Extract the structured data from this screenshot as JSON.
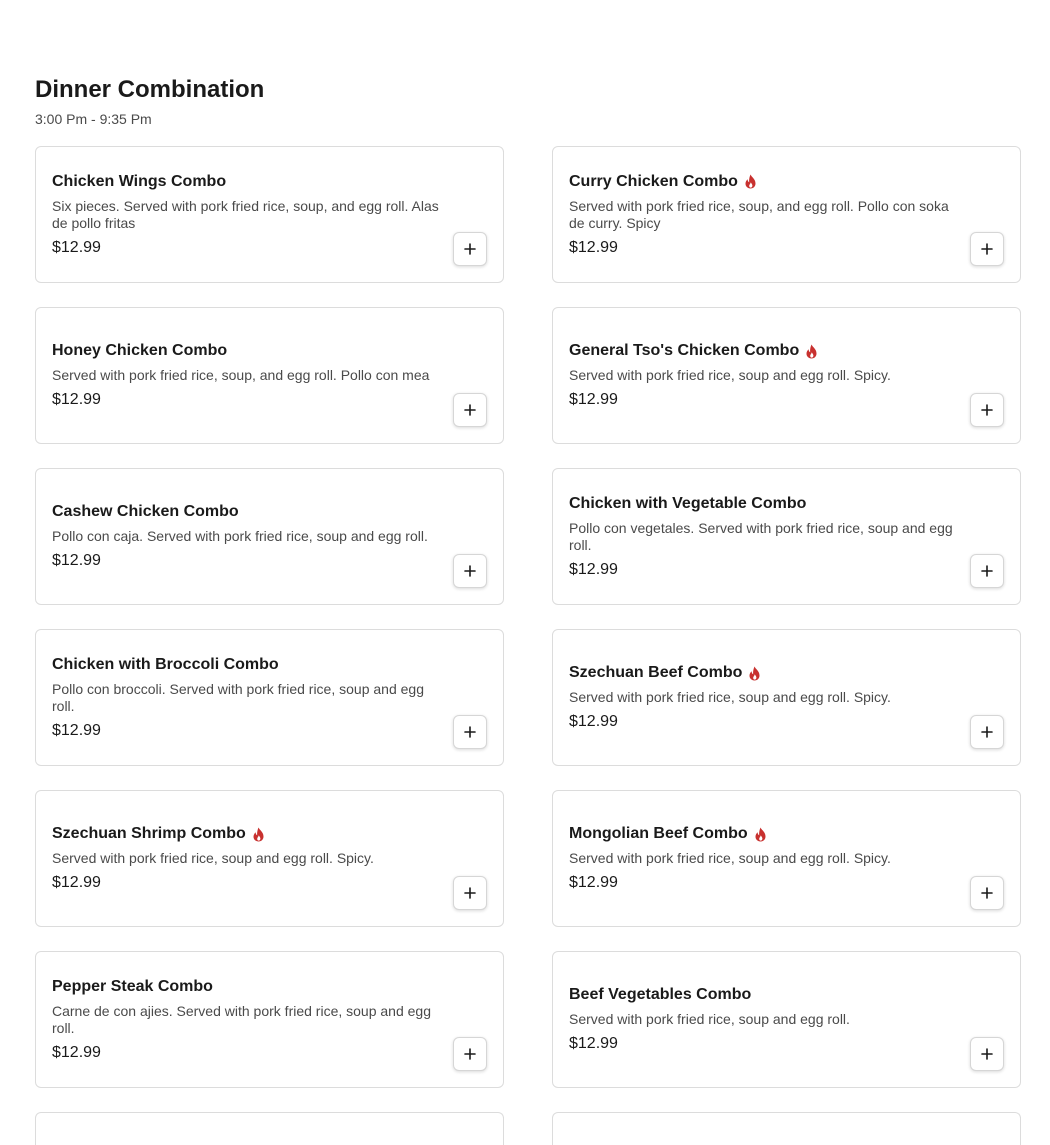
{
  "section": {
    "title": "Dinner Combination",
    "hours": "3:00 Pm - 9:35 Pm"
  },
  "colors": {
    "spicy": "#c8312f",
    "border": "#dcdcdc"
  },
  "icons": {
    "spicy": "flame-icon",
    "add": "plus-icon"
  },
  "items": [
    {
      "name": "Chicken Wings Combo",
      "spicy": false,
      "description": "Six pieces. Served with pork fried rice, soup, and egg roll. Alas de pollo fritas",
      "price": "$12.99"
    },
    {
      "name": "Curry Chicken Combo",
      "spicy": true,
      "description": "Served with pork fried rice, soup, and egg roll. Pollo con soka de curry. Spicy",
      "price": "$12.99"
    },
    {
      "name": "Honey Chicken Combo",
      "spicy": false,
      "description": "Served with pork fried rice, soup, and egg roll. Pollo con mea",
      "price": "$12.99"
    },
    {
      "name": "General Tso's Chicken Combo",
      "spicy": true,
      "description": "Served with pork fried rice, soup and egg roll. Spicy.",
      "price": "$12.99"
    },
    {
      "name": "Cashew Chicken Combo",
      "spicy": false,
      "description": "Pollo con caja. Served with pork fried rice, soup and egg roll.",
      "price": "$12.99"
    },
    {
      "name": "Chicken with Vegetable Combo",
      "spicy": false,
      "description": "Pollo con vegetales. Served with pork fried rice, soup and egg roll.",
      "price": "$12.99"
    },
    {
      "name": "Chicken with Broccoli Combo",
      "spicy": false,
      "description": "Pollo con broccoli. Served with pork fried rice, soup and egg roll.",
      "price": "$12.99"
    },
    {
      "name": "Szechuan Beef Combo",
      "spicy": true,
      "description": "Served with pork fried rice, soup and egg roll. Spicy.",
      "price": "$12.99"
    },
    {
      "name": "Szechuan Shrimp Combo",
      "spicy": true,
      "description": "Served with pork fried rice, soup and egg roll. Spicy.",
      "price": "$12.99"
    },
    {
      "name": "Mongolian Beef Combo",
      "spicy": true,
      "description": "Served with pork fried rice, soup and egg roll. Spicy.",
      "price": "$12.99"
    },
    {
      "name": "Pepper Steak Combo",
      "spicy": false,
      "description": "Carne de con ajies. Served with pork fried rice, soup and egg roll.",
      "price": "$12.99"
    },
    {
      "name": "Beef Vegetables Combo",
      "spicy": false,
      "description": "Served with pork fried rice, soup and egg roll.",
      "price": "$12.99"
    }
  ]
}
